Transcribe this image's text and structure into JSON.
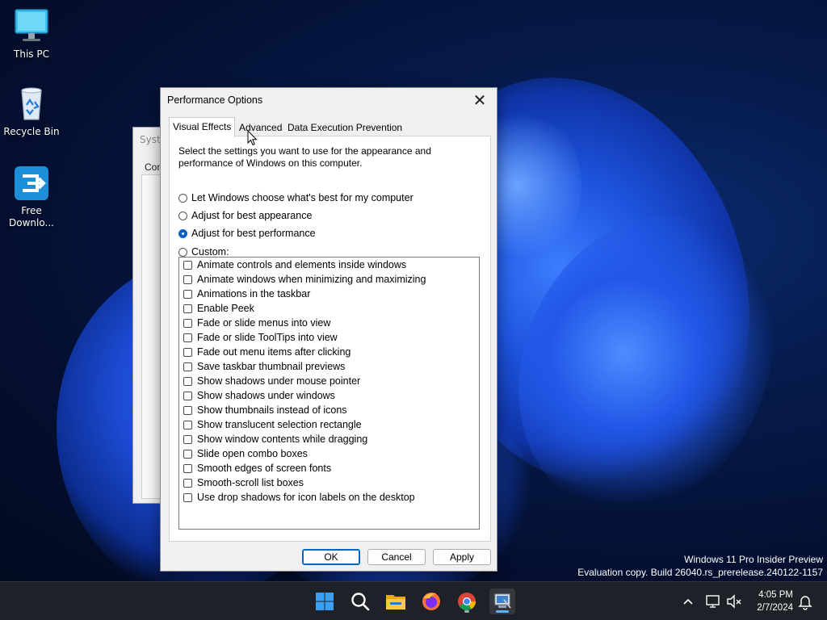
{
  "desktop": {
    "icons": [
      {
        "label": "This PC"
      },
      {
        "label": "Recycle Bin"
      },
      {
        "label": "Free Downlo..."
      }
    ],
    "watermark": {
      "line1": "Windows 11 Pro Insider Preview",
      "line2": "Evaluation copy. Build 26040.rs_prerelease.240122-1157"
    }
  },
  "background_window": {
    "title_fragment": "Syste",
    "tab_fragment": "Com"
  },
  "dialog": {
    "title": "Performance Options",
    "tabs": [
      {
        "label": "Visual Effects",
        "active": true
      },
      {
        "label": "Advanced",
        "active": false
      },
      {
        "label": "Data Execution Prevention",
        "active": false
      }
    ],
    "description": "Select the settings you want to use for the appearance and performance of Windows on this computer.",
    "radios": [
      {
        "label": "Let Windows choose what's best for my computer",
        "checked": false
      },
      {
        "label": "Adjust for best appearance",
        "checked": false
      },
      {
        "label": "Adjust for best performance",
        "checked": true
      },
      {
        "label": "Custom:",
        "checked": false
      }
    ],
    "effects": [
      {
        "label": "Animate controls and elements inside windows",
        "checked": false
      },
      {
        "label": "Animate windows when minimizing and maximizing",
        "checked": false
      },
      {
        "label": "Animations in the taskbar",
        "checked": false
      },
      {
        "label": "Enable Peek",
        "checked": false
      },
      {
        "label": "Fade or slide menus into view",
        "checked": false
      },
      {
        "label": "Fade or slide ToolTips into view",
        "checked": false
      },
      {
        "label": "Fade out menu items after clicking",
        "checked": false
      },
      {
        "label": "Save taskbar thumbnail previews",
        "checked": false
      },
      {
        "label": "Show shadows under mouse pointer",
        "checked": false
      },
      {
        "label": "Show shadows under windows",
        "checked": false
      },
      {
        "label": "Show thumbnails instead of icons",
        "checked": false
      },
      {
        "label": "Show translucent selection rectangle",
        "checked": false
      },
      {
        "label": "Show window contents while dragging",
        "checked": false
      },
      {
        "label": "Slide open combo boxes",
        "checked": false
      },
      {
        "label": "Smooth edges of screen fonts",
        "checked": false
      },
      {
        "label": "Smooth-scroll list boxes",
        "checked": false
      },
      {
        "label": "Use drop shadows for icon labels on the desktop",
        "checked": false
      }
    ],
    "buttons": {
      "ok": "OK",
      "cancel": "Cancel",
      "apply": "Apply"
    }
  },
  "taskbar": {
    "apps": [
      "start-icon",
      "search-icon",
      "file-explorer-icon",
      "firefox-icon",
      "chrome-icon",
      "system-properties-icon"
    ],
    "tray": {
      "time": "4:05 PM",
      "date": "2/7/2024"
    }
  },
  "colors": {
    "accent": "#0a5fc9",
    "taskbar": "#1f2128"
  }
}
